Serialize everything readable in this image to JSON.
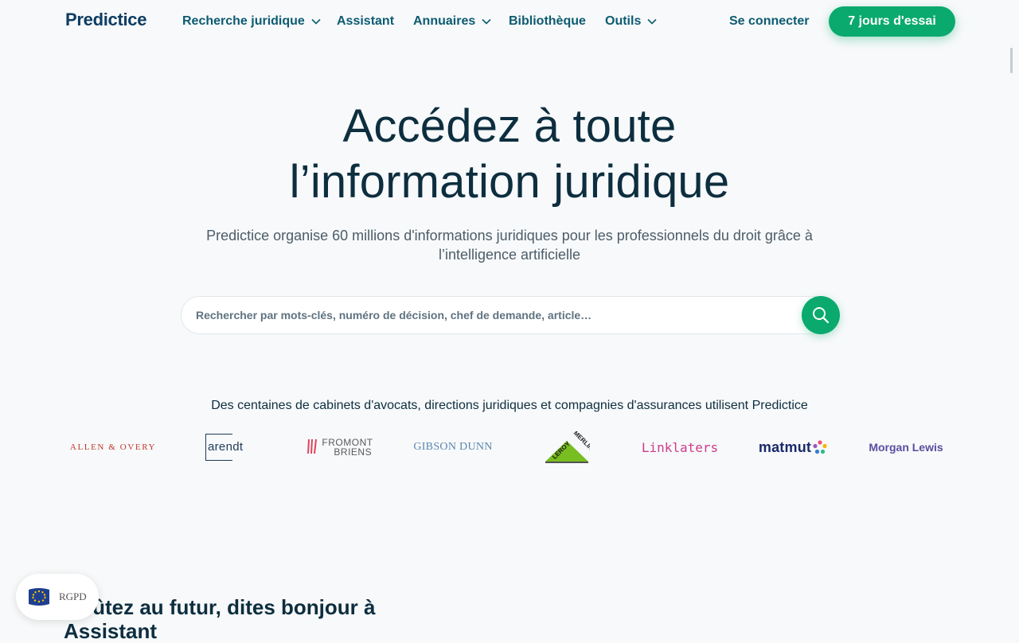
{
  "brand": {
    "name": "Predictice"
  },
  "nav": {
    "items": [
      {
        "label": "Recherche juridique",
        "dropdown": true
      },
      {
        "label": "Assistant",
        "dropdown": false
      },
      {
        "label": "Annuaires",
        "dropdown": true
      },
      {
        "label": "Bibliothèque",
        "dropdown": false
      },
      {
        "label": "Outils",
        "dropdown": true
      }
    ],
    "login_label": "Se connecter",
    "trial_label": "7 jours d'essai"
  },
  "hero": {
    "title_line1": "Accédez à toute",
    "title_line2": "l’information juridique",
    "subtitle": "Predictice organise 60 millions d'informations juridiques pour les professionnels du droit grâce à l’intelligence artificielle"
  },
  "search": {
    "placeholder": "Rechercher par mots-clés, numéro de décision, chef de demande, article…",
    "value": ""
  },
  "clients": {
    "caption": "Des centaines de cabinets d'avocats, directions juridiques et compagnies d'assurances utilisent Predictice",
    "logos": [
      {
        "name": "ALLEN & OVERY",
        "color": "#c0392b"
      },
      {
        "name": "arendt",
        "color": "#1f3a5a"
      },
      {
        "name": "FROMONT BRIENS",
        "color": "#5a5a5a",
        "accent": "#e0435e",
        "line1": "FROMONT",
        "line2": "BRIENS"
      },
      {
        "name": "GIBSON DUNN",
        "color": "#5b87b0"
      },
      {
        "name": "LEROY MERLIN",
        "color": "#1a1a1a",
        "accent": "#78be20"
      },
      {
        "name": "Linklaters",
        "color": "#d03a8c"
      },
      {
        "name": "matmut",
        "color": "#1a2a6c"
      },
      {
        "name": "Morgan Lewis",
        "color": "#5a4ea0"
      }
    ]
  },
  "section": {
    "title": "Goûtez au futur, dites bonjour à Assistant"
  },
  "rgpd": {
    "label": "RGPD"
  },
  "colors": {
    "primary_green": "#0aaa6e",
    "nav_text": "#0d5b72",
    "heading": "#0d2e3f",
    "background": "#f7f9fa"
  }
}
